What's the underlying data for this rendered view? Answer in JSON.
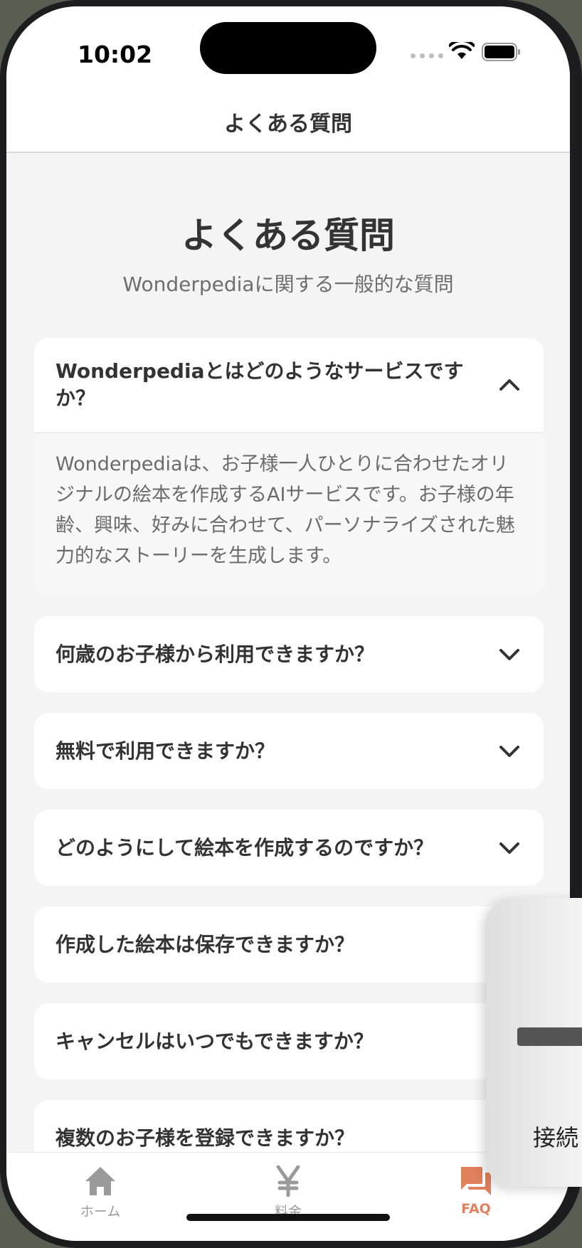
{
  "status_bar": {
    "time": "10:02"
  },
  "navbar": {
    "title": "よくある質問"
  },
  "page": {
    "title": "よくある質問",
    "subtitle": "Wonderpediaに関する一般的な質問"
  },
  "faqs": [
    {
      "question": "Wonderpediaとはどのようなサービスですか？",
      "answer": "Wonderpediaは、お子様一人ひとりに合わせたオリジナルの絵本を作成するAIサービスです。お子様の年齢、興味、好みに合わせて、パーソナライズされた魅力的なストーリーを生成します。",
      "expanded": true
    },
    {
      "question": "何歳のお子様から利用できますか？",
      "expanded": false
    },
    {
      "question": "無料で利用できますか？",
      "expanded": false
    },
    {
      "question": "どのようにして絵本を作成するのですか？",
      "expanded": false
    },
    {
      "question": "作成した絵本は保存できますか？",
      "expanded": false
    },
    {
      "question": "キャンセルはいつでもできますか？",
      "expanded": false
    },
    {
      "question": "複数のお子様を登録できますか？",
      "expanded": false
    }
  ],
  "popup": {
    "text": "接続"
  },
  "tabs": [
    {
      "label": "ホーム",
      "icon": "home-icon",
      "active": false
    },
    {
      "label": "料金",
      "icon": "yen-icon",
      "active": false
    },
    {
      "label": "FAQ",
      "icon": "chat-icon",
      "active": true
    }
  ],
  "colors": {
    "accent": "#e0805d",
    "inactive": "#9a9a9a"
  }
}
